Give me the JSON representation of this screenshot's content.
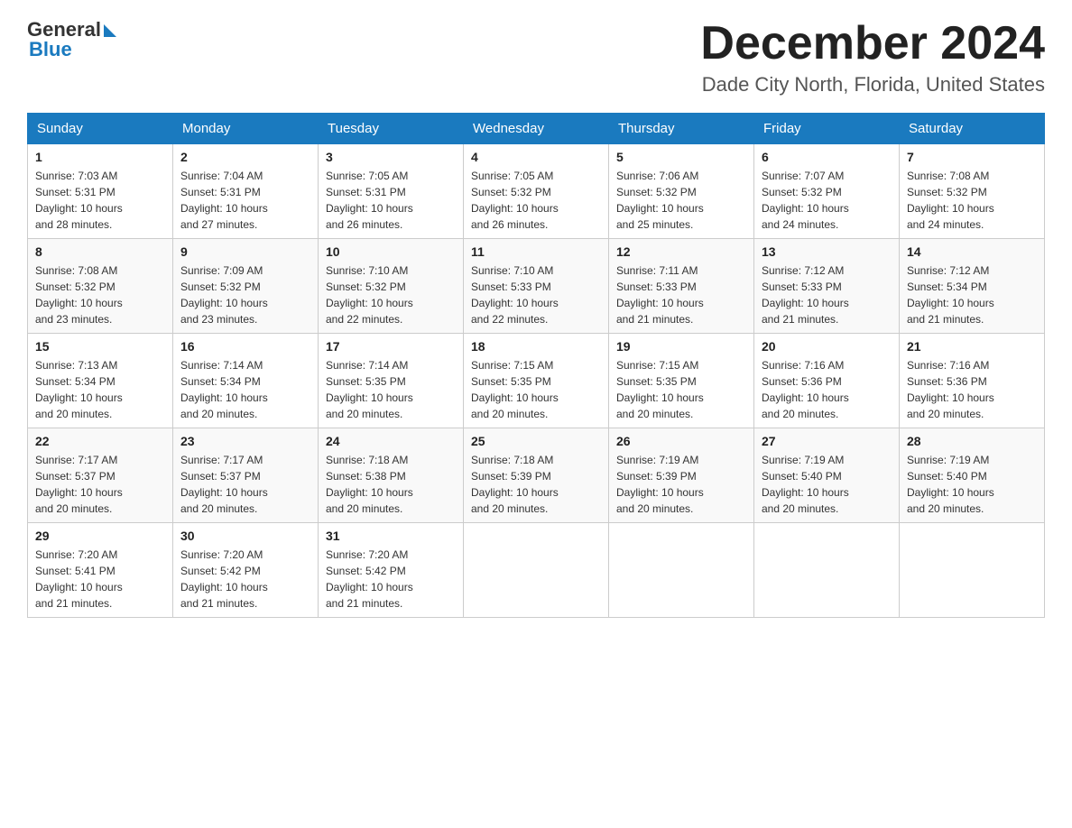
{
  "header": {
    "logo_general": "General",
    "logo_blue": "Blue",
    "month_title": "December 2024",
    "location": "Dade City North, Florida, United States"
  },
  "days_of_week": [
    "Sunday",
    "Monday",
    "Tuesday",
    "Wednesday",
    "Thursday",
    "Friday",
    "Saturday"
  ],
  "weeks": [
    [
      {
        "day": "1",
        "sunrise": "7:03 AM",
        "sunset": "5:31 PM",
        "daylight": "10 hours and 28 minutes."
      },
      {
        "day": "2",
        "sunrise": "7:04 AM",
        "sunset": "5:31 PM",
        "daylight": "10 hours and 27 minutes."
      },
      {
        "day": "3",
        "sunrise": "7:05 AM",
        "sunset": "5:31 PM",
        "daylight": "10 hours and 26 minutes."
      },
      {
        "day": "4",
        "sunrise": "7:05 AM",
        "sunset": "5:32 PM",
        "daylight": "10 hours and 26 minutes."
      },
      {
        "day": "5",
        "sunrise": "7:06 AM",
        "sunset": "5:32 PM",
        "daylight": "10 hours and 25 minutes."
      },
      {
        "day": "6",
        "sunrise": "7:07 AM",
        "sunset": "5:32 PM",
        "daylight": "10 hours and 24 minutes."
      },
      {
        "day": "7",
        "sunrise": "7:08 AM",
        "sunset": "5:32 PM",
        "daylight": "10 hours and 24 minutes."
      }
    ],
    [
      {
        "day": "8",
        "sunrise": "7:08 AM",
        "sunset": "5:32 PM",
        "daylight": "10 hours and 23 minutes."
      },
      {
        "day": "9",
        "sunrise": "7:09 AM",
        "sunset": "5:32 PM",
        "daylight": "10 hours and 23 minutes."
      },
      {
        "day": "10",
        "sunrise": "7:10 AM",
        "sunset": "5:32 PM",
        "daylight": "10 hours and 22 minutes."
      },
      {
        "day": "11",
        "sunrise": "7:10 AM",
        "sunset": "5:33 PM",
        "daylight": "10 hours and 22 minutes."
      },
      {
        "day": "12",
        "sunrise": "7:11 AM",
        "sunset": "5:33 PM",
        "daylight": "10 hours and 21 minutes."
      },
      {
        "day": "13",
        "sunrise": "7:12 AM",
        "sunset": "5:33 PM",
        "daylight": "10 hours and 21 minutes."
      },
      {
        "day": "14",
        "sunrise": "7:12 AM",
        "sunset": "5:34 PM",
        "daylight": "10 hours and 21 minutes."
      }
    ],
    [
      {
        "day": "15",
        "sunrise": "7:13 AM",
        "sunset": "5:34 PM",
        "daylight": "10 hours and 20 minutes."
      },
      {
        "day": "16",
        "sunrise": "7:14 AM",
        "sunset": "5:34 PM",
        "daylight": "10 hours and 20 minutes."
      },
      {
        "day": "17",
        "sunrise": "7:14 AM",
        "sunset": "5:35 PM",
        "daylight": "10 hours and 20 minutes."
      },
      {
        "day": "18",
        "sunrise": "7:15 AM",
        "sunset": "5:35 PM",
        "daylight": "10 hours and 20 minutes."
      },
      {
        "day": "19",
        "sunrise": "7:15 AM",
        "sunset": "5:35 PM",
        "daylight": "10 hours and 20 minutes."
      },
      {
        "day": "20",
        "sunrise": "7:16 AM",
        "sunset": "5:36 PM",
        "daylight": "10 hours and 20 minutes."
      },
      {
        "day": "21",
        "sunrise": "7:16 AM",
        "sunset": "5:36 PM",
        "daylight": "10 hours and 20 minutes."
      }
    ],
    [
      {
        "day": "22",
        "sunrise": "7:17 AM",
        "sunset": "5:37 PM",
        "daylight": "10 hours and 20 minutes."
      },
      {
        "day": "23",
        "sunrise": "7:17 AM",
        "sunset": "5:37 PM",
        "daylight": "10 hours and 20 minutes."
      },
      {
        "day": "24",
        "sunrise": "7:18 AM",
        "sunset": "5:38 PM",
        "daylight": "10 hours and 20 minutes."
      },
      {
        "day": "25",
        "sunrise": "7:18 AM",
        "sunset": "5:39 PM",
        "daylight": "10 hours and 20 minutes."
      },
      {
        "day": "26",
        "sunrise": "7:19 AM",
        "sunset": "5:39 PM",
        "daylight": "10 hours and 20 minutes."
      },
      {
        "day": "27",
        "sunrise": "7:19 AM",
        "sunset": "5:40 PM",
        "daylight": "10 hours and 20 minutes."
      },
      {
        "day": "28",
        "sunrise": "7:19 AM",
        "sunset": "5:40 PM",
        "daylight": "10 hours and 20 minutes."
      }
    ],
    [
      {
        "day": "29",
        "sunrise": "7:20 AM",
        "sunset": "5:41 PM",
        "daylight": "10 hours and 21 minutes."
      },
      {
        "day": "30",
        "sunrise": "7:20 AM",
        "sunset": "5:42 PM",
        "daylight": "10 hours and 21 minutes."
      },
      {
        "day": "31",
        "sunrise": "7:20 AM",
        "sunset": "5:42 PM",
        "daylight": "10 hours and 21 minutes."
      },
      null,
      null,
      null,
      null
    ]
  ],
  "labels": {
    "sunrise": "Sunrise:",
    "sunset": "Sunset:",
    "daylight": "Daylight:"
  }
}
